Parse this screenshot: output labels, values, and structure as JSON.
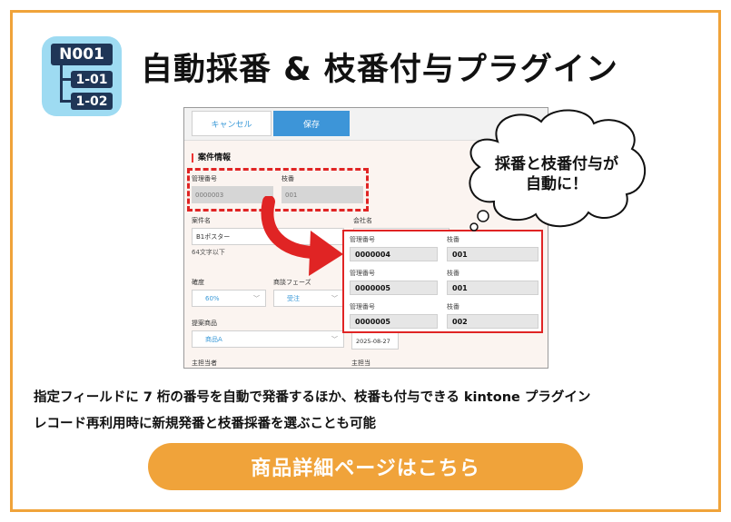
{
  "icon": {
    "main": "N001",
    "sub1": "1-01",
    "sub2": "1-02"
  },
  "title": "自動採番 & 枝番付与プラグイン",
  "shot": {
    "cancel": "キャンセル",
    "save": "保存",
    "section": "案件情報",
    "labels": {
      "manage_no": "管理番号",
      "branch": "枝番",
      "project": "案件名",
      "company": "会社名",
      "hint": "64文字以下",
      "accuracy": "確度",
      "phase": "商談フェーズ",
      "product": "提案商品",
      "sales_rep": "主担当者",
      "owner": "主担当"
    },
    "values": {
      "manage_no": "0000003",
      "branch": "001",
      "project": "B1ポスター",
      "accuracy": "60%",
      "phase": "受注",
      "product": "商品A",
      "date": "2025-08-27"
    }
  },
  "result": {
    "rows": [
      {
        "label_a": "管理番号",
        "label_b": "枝番",
        "a": "0000004",
        "b": "001"
      },
      {
        "label_a": "管理番号",
        "label_b": "枝番",
        "a": "0000005",
        "b": "001"
      },
      {
        "label_a": "管理番号",
        "label_b": "枝番",
        "a": "0000005",
        "b": "002"
      }
    ]
  },
  "bubble": {
    "line1": "採番と枝番付与が",
    "line2": "自動に！"
  },
  "description": {
    "line1": "指定フィールドに 7 桁の番号を自動で発番するほか、枝番も付与できる kintone プラグイン",
    "line2": "レコード再利用時に新規発番と枝番採番を選ぶことも可能"
  },
  "cta": "商品詳細ページはこちら",
  "colors": {
    "accent": "#f0a33a",
    "icon_bg": "#9edbf2",
    "icon_tag": "#1f3657",
    "highlight": "#e02424",
    "save": "#3d95d8"
  }
}
